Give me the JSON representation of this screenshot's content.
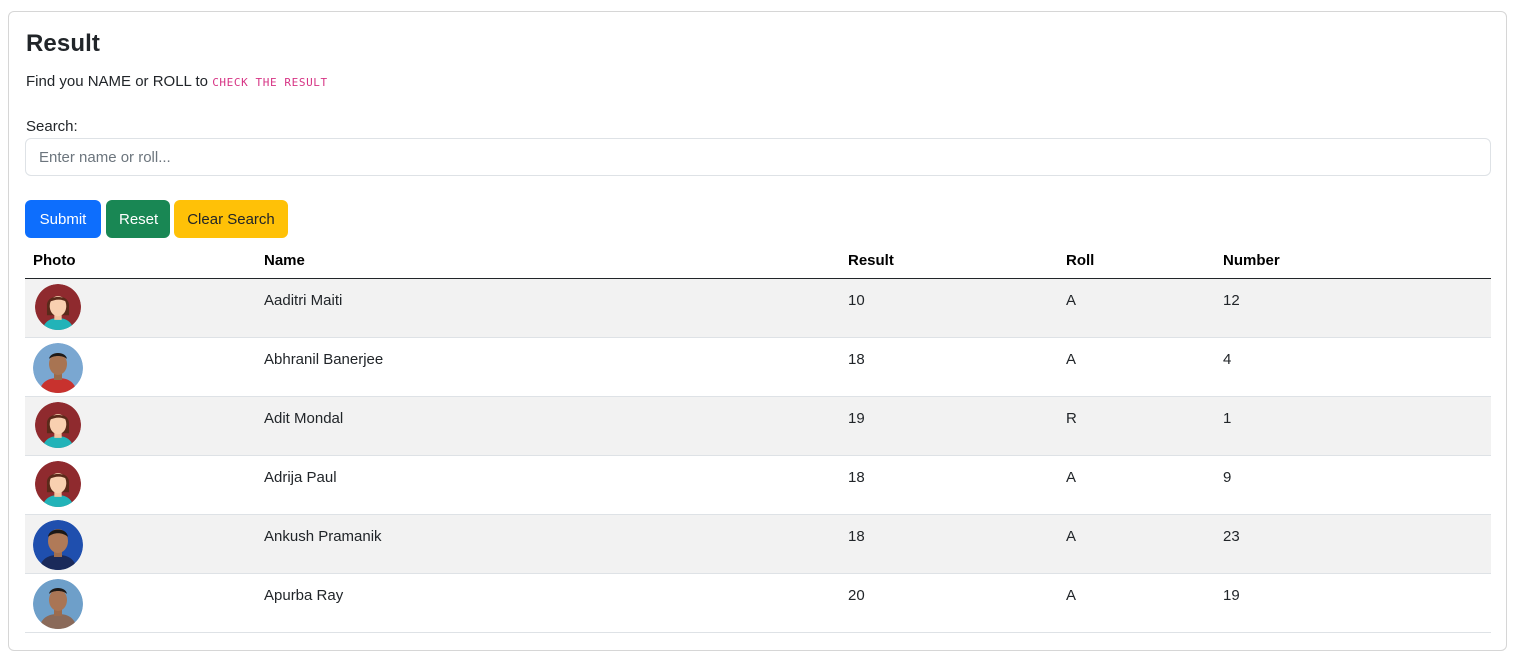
{
  "header": {
    "title": "Result",
    "subtitle_prefix": "Find you NAME or ROLL to ",
    "subtitle_code": "CHECK THE RESULT"
  },
  "search": {
    "label": "Search:",
    "placeholder": "Enter name or roll...",
    "value": ""
  },
  "buttons": {
    "submit": "Submit",
    "reset": "Reset",
    "clear": "Clear Search"
  },
  "colors": {
    "primary": "#0d6efd",
    "success": "#198754",
    "warning": "#ffc107",
    "code": "#d63384"
  },
  "table": {
    "headers": [
      "Photo",
      "Name",
      "Result",
      "Roll",
      "Number"
    ],
    "rows": [
      {
        "avatar": "female-avatar-icon",
        "name": "Aaditri Maiti",
        "result": "10",
        "roll": "A",
        "number": "12"
      },
      {
        "avatar": "boy-photo",
        "name": "Abhranil Banerjee",
        "result": "18",
        "roll": "A",
        "number": "4"
      },
      {
        "avatar": "female-avatar-icon",
        "name": "Adit Mondal",
        "result": "19",
        "roll": "R",
        "number": "1"
      },
      {
        "avatar": "female-avatar-icon",
        "name": "Adrija Paul",
        "result": "18",
        "roll": "A",
        "number": "9"
      },
      {
        "avatar": "boy-photo",
        "name": "Ankush Pramanik",
        "result": "18",
        "roll": "A",
        "number": "23"
      },
      {
        "avatar": "boy-photo",
        "name": "Apurba Ray",
        "result": "20",
        "roll": "A",
        "number": "19"
      }
    ]
  }
}
